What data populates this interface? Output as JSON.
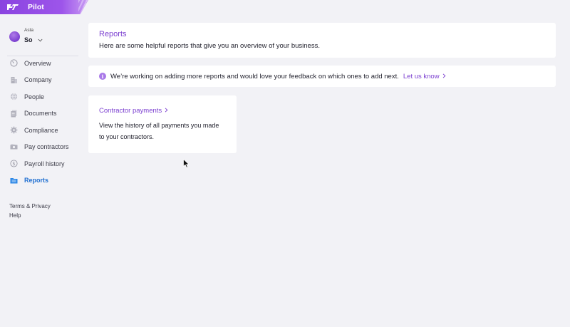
{
  "brand": {
    "name": "Pilot",
    "color": "#8a44e0"
  },
  "account": {
    "label": "Asta",
    "name": "So"
  },
  "sidebar": {
    "items": [
      {
        "label": "Overview",
        "icon": "gauge-icon"
      },
      {
        "label": "Company",
        "icon": "building-icon"
      },
      {
        "label": "People",
        "icon": "globe-icon"
      },
      {
        "label": "Documents",
        "icon": "document-icon"
      },
      {
        "label": "Compliance",
        "icon": "gear-icon"
      },
      {
        "label": "Pay contractors",
        "icon": "money-icon"
      },
      {
        "label": "Payroll history",
        "icon": "dollar-circle-icon"
      },
      {
        "label": "Reports",
        "icon": "folder-icon",
        "active": true
      }
    ],
    "footer": {
      "terms": "Terms & Privacy",
      "help": "Help"
    }
  },
  "header": {
    "title": "Reports",
    "subtitle": "Here are some helpful reports that give you an overview of your business."
  },
  "banner": {
    "icon": "info-icon",
    "text": "We’re working on adding more reports and would love your feedback on which ones to add next.",
    "link": "Let us know"
  },
  "reports": [
    {
      "title": "Contractor payments",
      "description": "View the history of all payments you made to your contractors."
    }
  ],
  "colors": {
    "accent": "#7b3fd0",
    "active_nav": "#1f6fd1",
    "background": "#f2f2f6"
  }
}
